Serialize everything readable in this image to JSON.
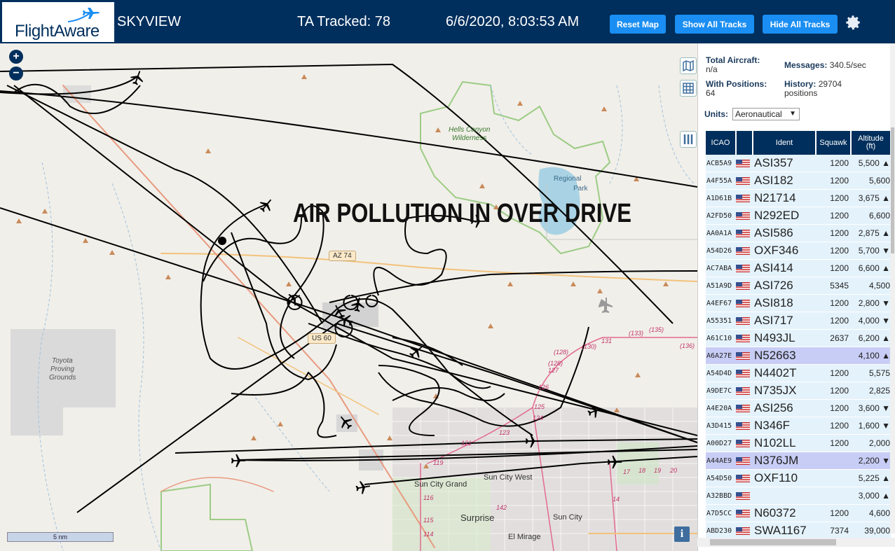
{
  "header": {
    "brand": "FlightAware",
    "app_name": "SKYVIEW",
    "tracked": "TA Tracked: 78",
    "datetime": "6/6/2020, 8:03:53 AM",
    "buttons": {
      "reset": "Reset Map",
      "show": "Show All Tracks",
      "hide": "Hide All Tracks"
    }
  },
  "map": {
    "overlay_text": "AIR POLLUTION IN OVER DRIVE",
    "labels": {
      "hells_canyon": "Hells Canyon",
      "wilderness": "Wilderness",
      "regional": "Regional",
      "park": "Park",
      "toyota": "Toyota",
      "proving": "Proving",
      "grounds": "Grounds",
      "sun_city_grand": "Sun City Grand",
      "sun_city_west": "Sun City West",
      "sun_city": "Sun City",
      "surprise": "Surprise",
      "el_mirage": "El Mirage",
      "az74": "AZ 74",
      "us60": "US 60"
    },
    "route_numbers": [
      "(128)",
      "(130)",
      "131",
      "(133)",
      "(135)",
      "(136)",
      "(128)",
      "127",
      "126",
      "125",
      "124",
      "123",
      "121",
      "119",
      "116",
      "115",
      "114",
      "142",
      "17",
      "18",
      "19",
      "20",
      "14"
    ],
    "scale": "5 nm",
    "zoom_in": "+",
    "zoom_out": "−",
    "info": "i"
  },
  "panel": {
    "total_aircraft_label": "Total Aircraft:",
    "total_aircraft_value": "n/a",
    "messages_label": "Messages:",
    "messages_value": "340.5/sec",
    "with_positions_label": "With Positions:",
    "with_positions_value": "64",
    "history_label": "History:",
    "history_value": "29704",
    "history_unit": "positions",
    "units_label": "Units:",
    "units_value": "Aeronautical"
  },
  "table": {
    "headers": {
      "icao": "ICAO",
      "ident": "Ident",
      "squawk": "Squawk",
      "altitude": "Altitude",
      "altitude_unit": "(ft)"
    },
    "rows": [
      {
        "icao": "ACB5A9",
        "ident": "ASI357",
        "squawk": "1200",
        "alt": "5,500 ▲",
        "sel": false
      },
      {
        "icao": "A4F55A",
        "ident": "ASI182",
        "squawk": "1200",
        "alt": "5,600",
        "sel": false
      },
      {
        "icao": "A1D61B",
        "ident": "N21714",
        "squawk": "1200",
        "alt": "3,675 ▲",
        "sel": false
      },
      {
        "icao": "A2FD50",
        "ident": "N292ED",
        "squawk": "1200",
        "alt": "6,600",
        "sel": false
      },
      {
        "icao": "AA0A1A",
        "ident": "ASI586",
        "squawk": "1200",
        "alt": "2,875 ▲",
        "sel": false
      },
      {
        "icao": "A54D26",
        "ident": "OXF346",
        "squawk": "1200",
        "alt": "5,700 ▼",
        "sel": false
      },
      {
        "icao": "AC7ABA",
        "ident": "ASI414",
        "squawk": "1200",
        "alt": "6,600 ▲",
        "sel": false
      },
      {
        "icao": "A51A9D",
        "ident": "ASI726",
        "squawk": "5345",
        "alt": "4,500",
        "sel": false
      },
      {
        "icao": "A4EF67",
        "ident": "ASI818",
        "squawk": "1200",
        "alt": "2,800 ▼",
        "sel": false
      },
      {
        "icao": "A55351",
        "ident": "ASI717",
        "squawk": "1200",
        "alt": "4,000 ▼",
        "sel": false
      },
      {
        "icao": "A61C10",
        "ident": "N493JL",
        "squawk": "2637",
        "alt": "6,200 ▲",
        "sel": false
      },
      {
        "icao": "A6A27E",
        "ident": "N52663",
        "squawk": "",
        "alt": "4,100 ▲",
        "sel": true
      },
      {
        "icao": "A54D4D",
        "ident": "N4402T",
        "squawk": "1200",
        "alt": "5,575",
        "sel": false
      },
      {
        "icao": "A9DE7C",
        "ident": "N735JX",
        "squawk": "1200",
        "alt": "2,825",
        "sel": false
      },
      {
        "icao": "A4E20A",
        "ident": "ASI256",
        "squawk": "1200",
        "alt": "3,600 ▼",
        "sel": false
      },
      {
        "icao": "A3D415",
        "ident": "N346F",
        "squawk": "1200",
        "alt": "1,600 ▼",
        "sel": false
      },
      {
        "icao": "A00D27",
        "ident": "N102LL",
        "squawk": "1200",
        "alt": "2,000",
        "sel": false
      },
      {
        "icao": "A44AE9",
        "ident": "N376JM",
        "squawk": "",
        "alt": "2,200 ▼",
        "sel": true
      },
      {
        "icao": "A54D50",
        "ident": "OXF110",
        "squawk": "",
        "alt": "5,225 ▲",
        "sel": false
      },
      {
        "icao": "A32BBD",
        "ident": "",
        "squawk": "",
        "alt": "3,000 ▲",
        "sel": false
      },
      {
        "icao": "A7D5CC",
        "ident": "N60372",
        "squawk": "1200",
        "alt": "4,600",
        "sel": false
      },
      {
        "icao": "ABD230",
        "ident": "SWA1167",
        "squawk": "7374",
        "alt": "39,000",
        "sel": false
      }
    ]
  },
  "colors": {
    "header_bg": "#002F5D",
    "button_bg": "#1a8ef2",
    "row_bg": "#e4f2fb",
    "row_selected": "#c8cdf5"
  }
}
